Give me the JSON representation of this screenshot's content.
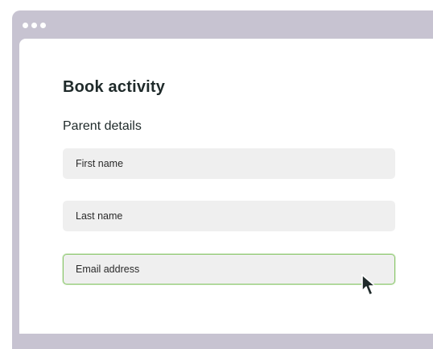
{
  "window": {
    "dots_color": "#ffffff",
    "chrome_color": "#c7c3d1"
  },
  "form": {
    "title": "Book activity",
    "section_title": "Parent details",
    "fields": {
      "first_name_placeholder": "First name",
      "last_name_placeholder": "Last name",
      "email_placeholder": "Email address"
    },
    "focus_color": "#8ac66a"
  },
  "cursor": {
    "icon": "arrow-pointer-icon"
  }
}
